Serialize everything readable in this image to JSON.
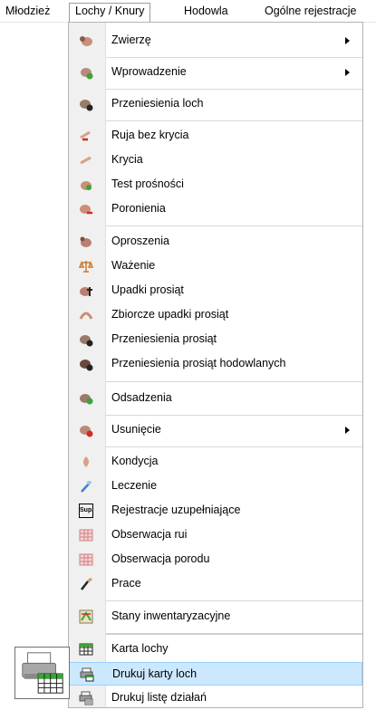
{
  "menubar": {
    "items": [
      {
        "label": "Młodzież"
      },
      {
        "label": "Lochy / Knury"
      },
      {
        "label": "Hodowla"
      },
      {
        "label": "Ogólne rejestracje"
      }
    ]
  },
  "dropdown": {
    "items": [
      {
        "label": "Zwierzę",
        "icon": "sow-icon",
        "submenu": true
      },
      {
        "label": "Wprowadzenie",
        "icon": "sow-add-icon",
        "submenu": true
      },
      {
        "label": "Przeniesienia loch",
        "icon": "sow-transfer-icon"
      },
      {
        "label": "Ruja bez krycia",
        "icon": "heat-no-mating-icon"
      },
      {
        "label": "Krycia",
        "icon": "mating-icon"
      },
      {
        "label": "Test prośności",
        "icon": "pregnancy-test-icon"
      },
      {
        "label": "Poronienia",
        "icon": "abortion-icon"
      },
      {
        "label": "Oproszenia",
        "icon": "farrowing-icon"
      },
      {
        "label": "Ważenie",
        "icon": "scales-icon"
      },
      {
        "label": "Upadki prosiąt",
        "icon": "piglet-death-icon"
      },
      {
        "label": "Zbiorcze upadki prosiąt",
        "icon": "batch-piglet-death-icon"
      },
      {
        "label": "Przeniesienia prosiąt",
        "icon": "piglet-transfer-icon"
      },
      {
        "label": "Przeniesienia prosiąt hodowlanych",
        "icon": "breeding-piglet-transfer-icon"
      },
      {
        "label": "Odsadzenia",
        "icon": "weaning-icon"
      },
      {
        "label": "Usunięcie",
        "icon": "sow-remove-icon",
        "submenu": true
      },
      {
        "label": "Kondycja",
        "icon": "condition-icon"
      },
      {
        "label": "Leczenie",
        "icon": "syringe-icon"
      },
      {
        "label": "Rejestracje uzupełniające",
        "icon": "sup-icon",
        "icon_text": "Sup."
      },
      {
        "label": "Obserwacja rui",
        "icon": "heat-observation-grid-icon"
      },
      {
        "label": "Obserwacja porodu",
        "icon": "birth-observation-grid-icon"
      },
      {
        "label": "Prace",
        "icon": "brush-icon"
      },
      {
        "label": "Stany inwentaryzacyjne",
        "icon": "inventory-icon"
      },
      {
        "label": "Karta lochy",
        "icon": "sow-card-icon"
      },
      {
        "label": "Drukuj karty loch",
        "icon": "print-cards-icon"
      },
      {
        "label": "Drukuj listę działań",
        "icon": "print-list-icon"
      }
    ]
  },
  "colors": {
    "highlight": "#cce8ff",
    "highlight_border": "#99d1ff",
    "sow_pink": "#d9a08a",
    "sow_dark": "#3a3a3a",
    "red": "#d62828",
    "green": "#3aa335"
  }
}
